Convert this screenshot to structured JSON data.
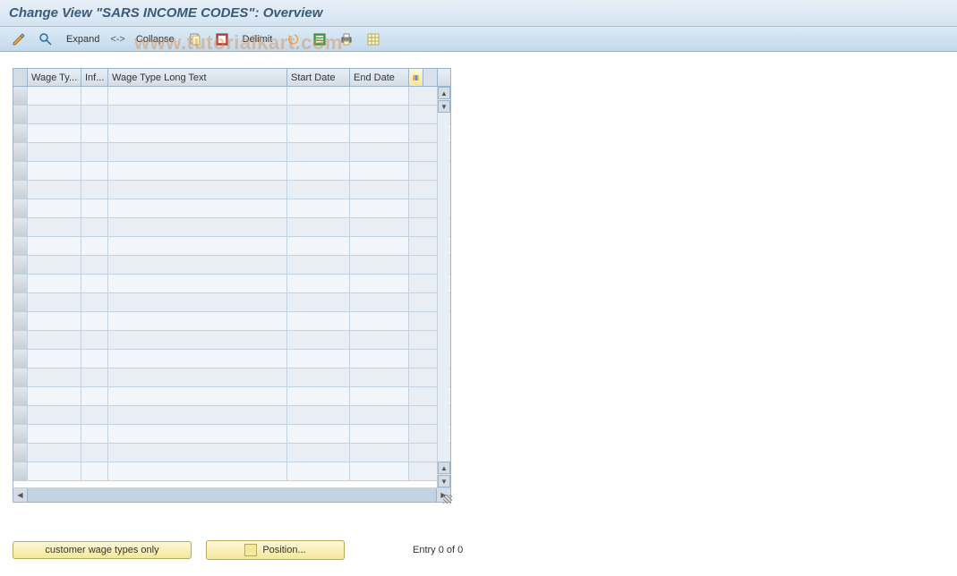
{
  "header": {
    "title": "Change View \"SARS INCOME CODES\": Overview"
  },
  "watermark": "www.tutorialkart.com",
  "toolbar": {
    "expand_label": "Expand",
    "sep_label": "<->",
    "collapse_label": "Collapse",
    "delimit_label": "Delimit"
  },
  "grid": {
    "columns": {
      "wage_type": "Wage Ty...",
      "inf": "Inf...",
      "long_text": "Wage Type Long Text",
      "start_date": "Start Date",
      "end_date": "End Date"
    },
    "rows": []
  },
  "footer": {
    "customer_button": "customer wage types only",
    "position_button": "Position...",
    "entry_text": "Entry 0 of 0"
  }
}
